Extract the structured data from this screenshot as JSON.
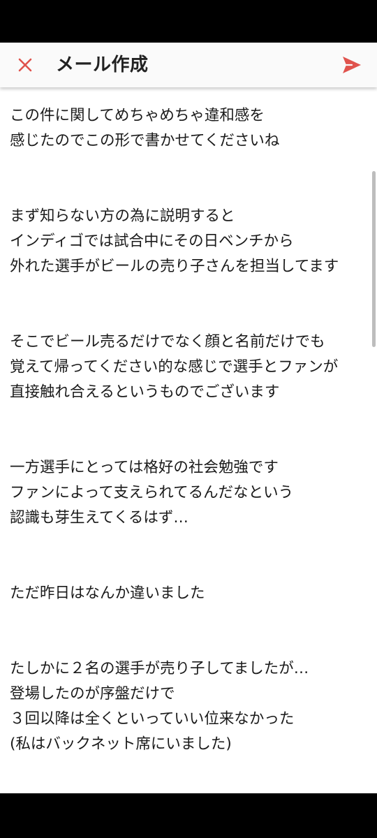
{
  "header": {
    "title": "メール作成",
    "close_icon": "close-icon",
    "send_icon": "send-icon"
  },
  "colors": {
    "accent": "#e0534d",
    "toolbar_bg": "#fafafa",
    "text": "#1a1a1a"
  },
  "compose": {
    "body": "この件に関してめちゃめちゃ違和感を\n感じたのでこの形で書かせてくださいね\n\n\nまず知らない方の為に説明すると\nインディゴでは試合中にその日ベンチから\n外れた選手がビールの売り子さんを担当してます\n\n\nそこでビール売るだけでなく顔と名前だけでも\n覚えて帰ってください的な感じで選手とファンが\n直接触れ合えるというものでございます\n\n\n一方選手にとっては格好の社会勉強です\nファンによって支えられてるんだなという\n認識も芽生えてくるはず…\n\n\nただ昨日はなんか違いました\n\n\nたしかに２名の選手が売り子してましたが…\n登場したのが序盤だけで\n３回以降は全くといっていい位来なかった\n(私はバックネット席にいました)"
  }
}
